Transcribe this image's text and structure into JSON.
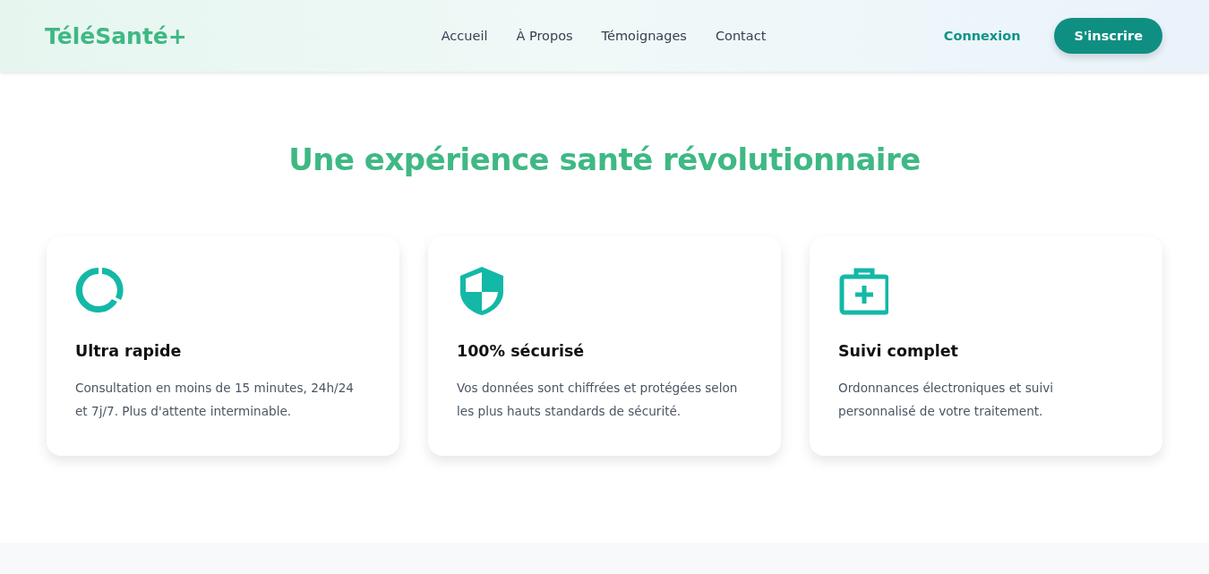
{
  "header": {
    "logo": "TéléSanté+",
    "nav": [
      {
        "label": "Accueil"
      },
      {
        "label": "À Propos"
      },
      {
        "label": "Témoignages"
      },
      {
        "label": "Contact"
      }
    ],
    "login": "Connexion",
    "signup": "S'inscrire"
  },
  "section": {
    "title": "Une expérience santé révolutionnaire",
    "cards": [
      {
        "title": "Ultra rapide",
        "text": "Consultation en moins de 15 minutes, 24h/24 et 7j/7. Plus d'attente interminable."
      },
      {
        "title": "100% sécurisé",
        "text": "Vos données sont chiffrées et protégées selon les plus hauts standards de sécurité."
      },
      {
        "title": "Suivi complet",
        "text": "Ordonnances électroniques et suivi personnalisé de votre traitement."
      }
    ]
  }
}
